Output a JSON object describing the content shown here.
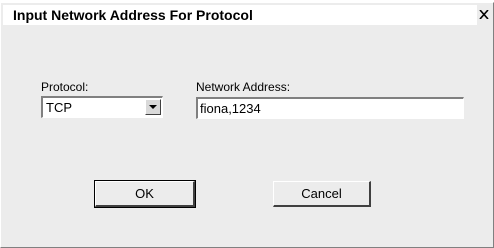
{
  "window": {
    "title": "Input Network Address For Protocol",
    "close_icon": "close-icon"
  },
  "form": {
    "protocol_label": "Protocol:",
    "protocol_value": "TCP",
    "protocol_dropdown_icon": "chevron-down-icon",
    "address_label": "Network Address:",
    "address_value": "fiona,1234"
  },
  "buttons": {
    "ok_label": "OK",
    "cancel_label": "Cancel"
  }
}
